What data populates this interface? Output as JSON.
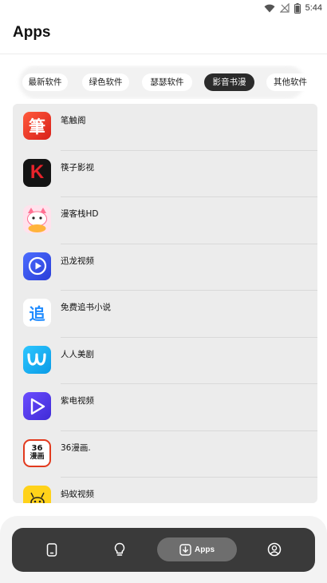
{
  "status_bar": {
    "time": "5:44",
    "icons": [
      "wifi-icon",
      "no-signal-icon",
      "battery-icon"
    ]
  },
  "header": {
    "title": "Apps"
  },
  "tabs": [
    {
      "label": "最新软件",
      "active": false
    },
    {
      "label": "绿色软件",
      "active": false
    },
    {
      "label": "瑟瑟软件",
      "active": false
    },
    {
      "label": "影音书漫",
      "active": true
    },
    {
      "label": "其他软件",
      "active": false
    }
  ],
  "apps": [
    {
      "name": "笔触阁",
      "icon": "bichuge-icon"
    },
    {
      "name": "筷子影视",
      "icon": "kuaizi-icon"
    },
    {
      "name": "漫客栈HD",
      "icon": "manke-icon"
    },
    {
      "name": "迅龙视频",
      "icon": "xunlong-icon"
    },
    {
      "name": "免费追书小说",
      "icon": "zhuishu-icon"
    },
    {
      "name": "人人美剧",
      "icon": "renren-icon"
    },
    {
      "name": "紫电视频",
      "icon": "zidian-icon"
    },
    {
      "name": "36漫画.",
      "icon": "manhua36-icon"
    },
    {
      "name": "蚂蚁视频",
      "icon": "mayi-icon"
    }
  ],
  "icon_glyphs": {
    "bichuge": "筆",
    "kuaizi": "K",
    "zhuishu": "追",
    "manhua36_top": "36",
    "manhua36_bottom": "漫画"
  },
  "bottom_nav": {
    "items": [
      {
        "name": "phone-icon",
        "label": ""
      },
      {
        "name": "lightbulb-icon",
        "label": ""
      },
      {
        "name": "download-icon",
        "label": "Apps",
        "active": true
      },
      {
        "name": "profile-icon",
        "label": ""
      }
    ]
  },
  "colors": {
    "active_tab": "#2b2b2b",
    "nav_bar": "#3a3a3a",
    "nav_active": "#6e6e6e"
  }
}
